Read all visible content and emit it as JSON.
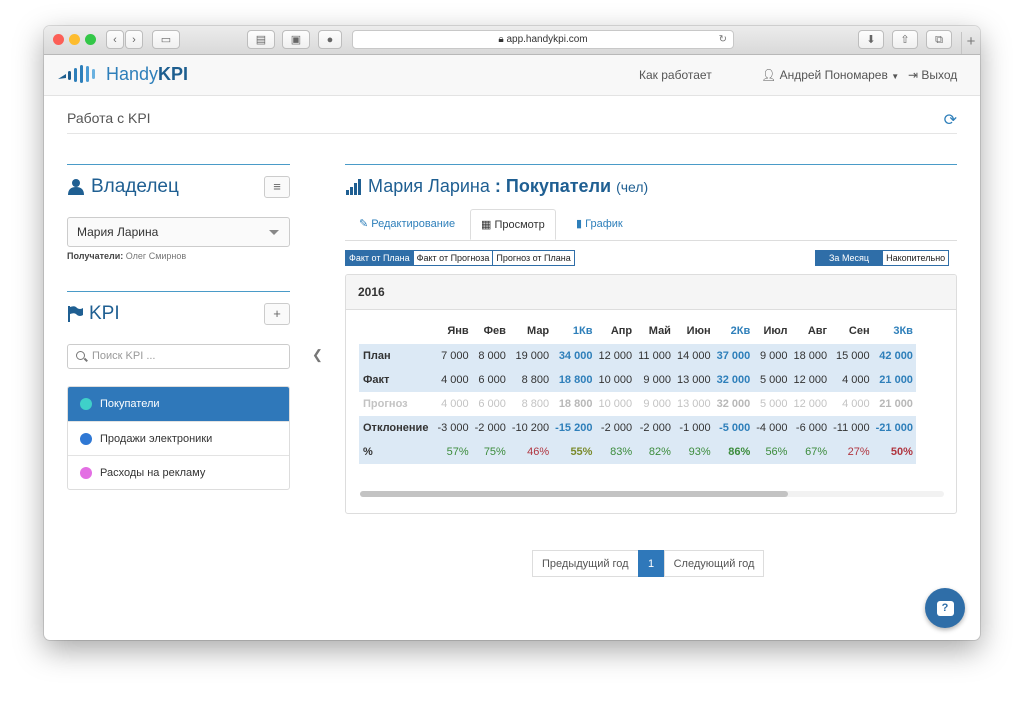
{
  "browser": {
    "url": "app.handykpi.com"
  },
  "navbar": {
    "brand_a": "Handy",
    "brand_b": "KPI",
    "how_it_works": "Как работает",
    "user": "Андрей Пономарев",
    "logout": "Выход"
  },
  "subheader": {
    "title": "Работа с KPI"
  },
  "owner": {
    "title": "Владелец",
    "selected": "Мария Ларина",
    "recipients_label": "Получатели:",
    "recipients": "Олег Смирнов"
  },
  "kpi": {
    "title": "KPI",
    "search_placeholder": "Поиск KPI ...",
    "items": [
      {
        "label": "Покупатели",
        "color": "#3fd0c9",
        "active": true
      },
      {
        "label": "Продажи электроники",
        "color": "#2f78d4",
        "active": false
      },
      {
        "label": "Расходы на рекламу",
        "color": "#e36fe3",
        "active": false
      }
    ]
  },
  "main": {
    "owner": "Мария Ларина",
    "separator": ":",
    "kpi_name": "Покупатели",
    "unit": "(чел)",
    "tabs": [
      "Редактирование",
      "Просмотр",
      "График"
    ],
    "active_tab": "Просмотр",
    "compare_modes": [
      "Факт от Плана",
      "Факт от Прогноза",
      "Прогноз от Плана"
    ],
    "period_modes": [
      "За Месяц",
      "Накопительно"
    ],
    "year": "2016"
  },
  "table": {
    "columns": [
      "Янв",
      "Фев",
      "Мар",
      "1Кв",
      "Апр",
      "Май",
      "Июн",
      "2Кв",
      "Июл",
      "Авг",
      "Сен",
      "3Кв"
    ],
    "quarter_columns": [
      "1Кв",
      "2Кв",
      "3Кв"
    ],
    "rows": [
      {
        "label": "План",
        "values": [
          "7 000",
          "8 000",
          "19 000",
          "34 000",
          "12 000",
          "11 000",
          "14 000",
          "37 000",
          "9 000",
          "18 000",
          "15 000",
          "42 000"
        ]
      },
      {
        "label": "Факт",
        "values": [
          "4 000",
          "6 000",
          "8 800",
          "18 800",
          "10 000",
          "9 000",
          "13 000",
          "32 000",
          "5 000",
          "12 000",
          "4 000",
          "21 000"
        ]
      },
      {
        "label": "Прогноз",
        "values": [
          "4 000",
          "6 000",
          "8 800",
          "18 800",
          "10 000",
          "9 000",
          "13 000",
          "32 000",
          "5 000",
          "12 000",
          "4 000",
          "21 000"
        ]
      },
      {
        "label": "Отклонение",
        "values": [
          "-3 000",
          "-2 000",
          "-10 200",
          "-15 200",
          "-2 000",
          "-2 000",
          "-1 000",
          "-5 000",
          "-4 000",
          "-6 000",
          "-11 000",
          "-21 000"
        ]
      },
      {
        "label": "%",
        "values": [
          "57%",
          "75%",
          "46%",
          "55%",
          "83%",
          "82%",
          "93%",
          "86%",
          "56%",
          "67%",
          "27%",
          "50%"
        ],
        "tones": [
          "green",
          "green",
          "red",
          "olive",
          "green",
          "green",
          "green",
          "green",
          "green",
          "green",
          "red",
          "red"
        ]
      }
    ]
  },
  "pager": {
    "prev": "Предыдущий год",
    "current": "1",
    "next": "Следующий год"
  },
  "help": {
    "label": "?"
  }
}
